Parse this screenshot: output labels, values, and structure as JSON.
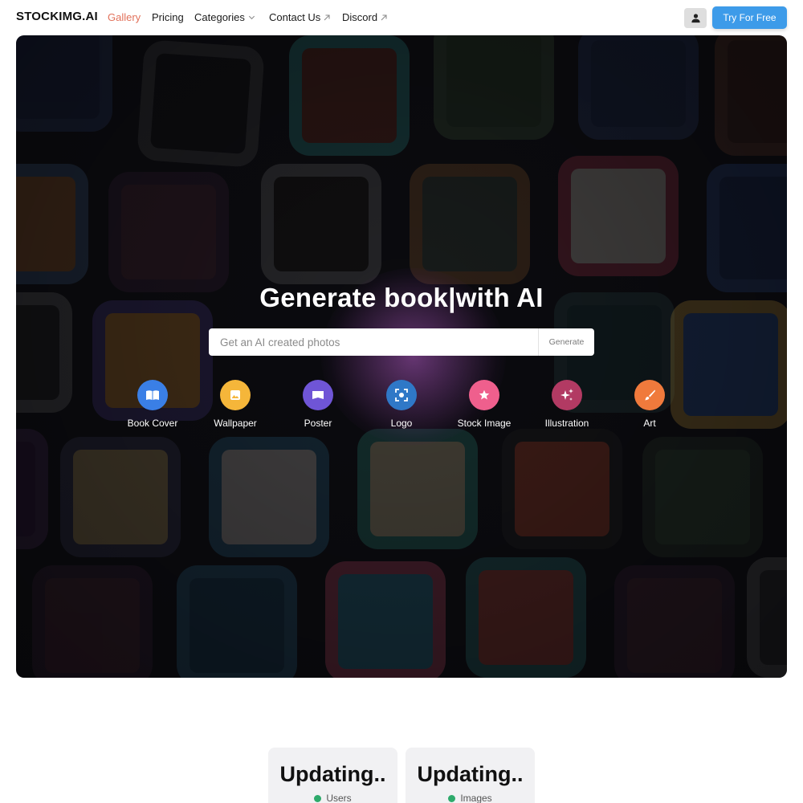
{
  "brand": "STOCKIMG.AI",
  "nav": {
    "gallery": "Gallery",
    "pricing": "Pricing",
    "categories": "Categories",
    "contact": "Contact Us",
    "discord": "Discord",
    "try_free": "Try For Free"
  },
  "hero": {
    "title": "Generate book|with AI",
    "search_placeholder": "Get an AI created photos",
    "generate_label": "Generate"
  },
  "categories": [
    {
      "label": "Book Cover",
      "icon": "book-icon",
      "color": "#3a7fe6"
    },
    {
      "label": "Wallpaper",
      "icon": "image-icon",
      "color": "#f5b63a"
    },
    {
      "label": "Poster",
      "icon": "flag-icon",
      "color": "#6f55d6"
    },
    {
      "label": "Logo",
      "icon": "focus-icon",
      "color": "#2f78c7"
    },
    {
      "label": "Stock Image",
      "icon": "star-icon",
      "color": "#ef5f8d"
    },
    {
      "label": "Illustration",
      "icon": "sparkles-icon",
      "color": "#b23a63"
    },
    {
      "label": "Art",
      "icon": "brush-icon",
      "color": "#f07a3c"
    }
  ],
  "stats": [
    {
      "value": "Updating..",
      "label": "Users",
      "dot_color": "#2eaa6b"
    },
    {
      "value": "Updating..",
      "label": "Images",
      "dot_color": "#2eaa6b"
    }
  ]
}
